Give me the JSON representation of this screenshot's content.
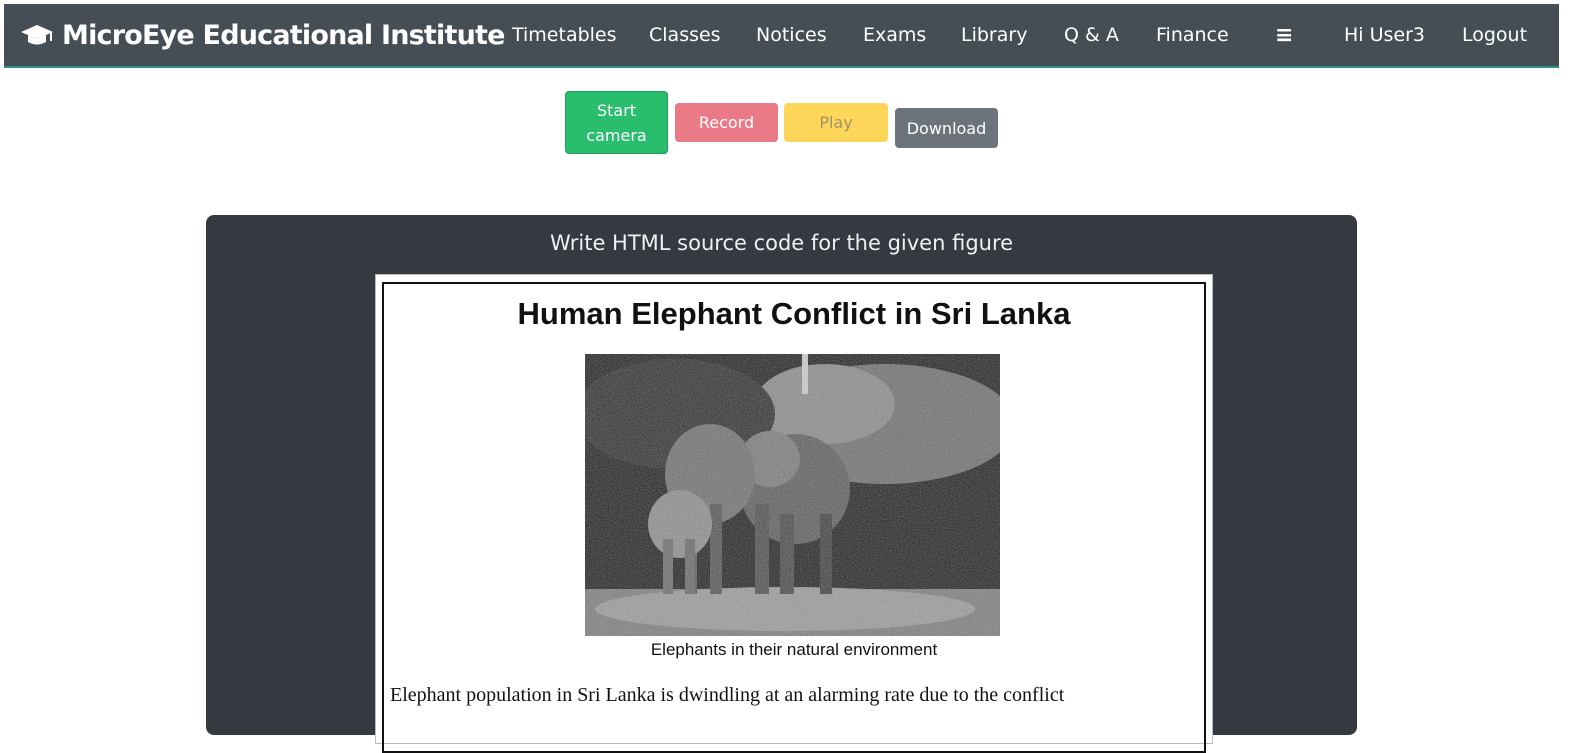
{
  "navbar": {
    "brand": "MicroEye Educational Institute",
    "items": [
      {
        "label": "Timetables"
      },
      {
        "label": "Classes"
      },
      {
        "label": "Notices"
      },
      {
        "label": "Exams"
      },
      {
        "label": "Library"
      },
      {
        "label": "Q & A"
      },
      {
        "label": "Finance"
      },
      {
        "label": "≡"
      },
      {
        "label": "Hi User3"
      },
      {
        "label": "Logout"
      }
    ],
    "bg_color": "#454d55"
  },
  "controls": {
    "start_camera": "Start camera",
    "record": "Record",
    "play": "Play",
    "download": "Download"
  },
  "panel": {
    "title": "Write HTML source code for the given figure",
    "figure": {
      "heading": "Human Elephant Conflict in Sri Lanka",
      "caption": "Elephants in their natural environment",
      "paragraph": "Elephant population in Sri Lanka is dwindling at an alarming rate due to the conflict"
    }
  },
  "icons": {
    "brand_icon": "graduation-cap-icon",
    "menu_icon": "hamburger-menu-icon"
  }
}
